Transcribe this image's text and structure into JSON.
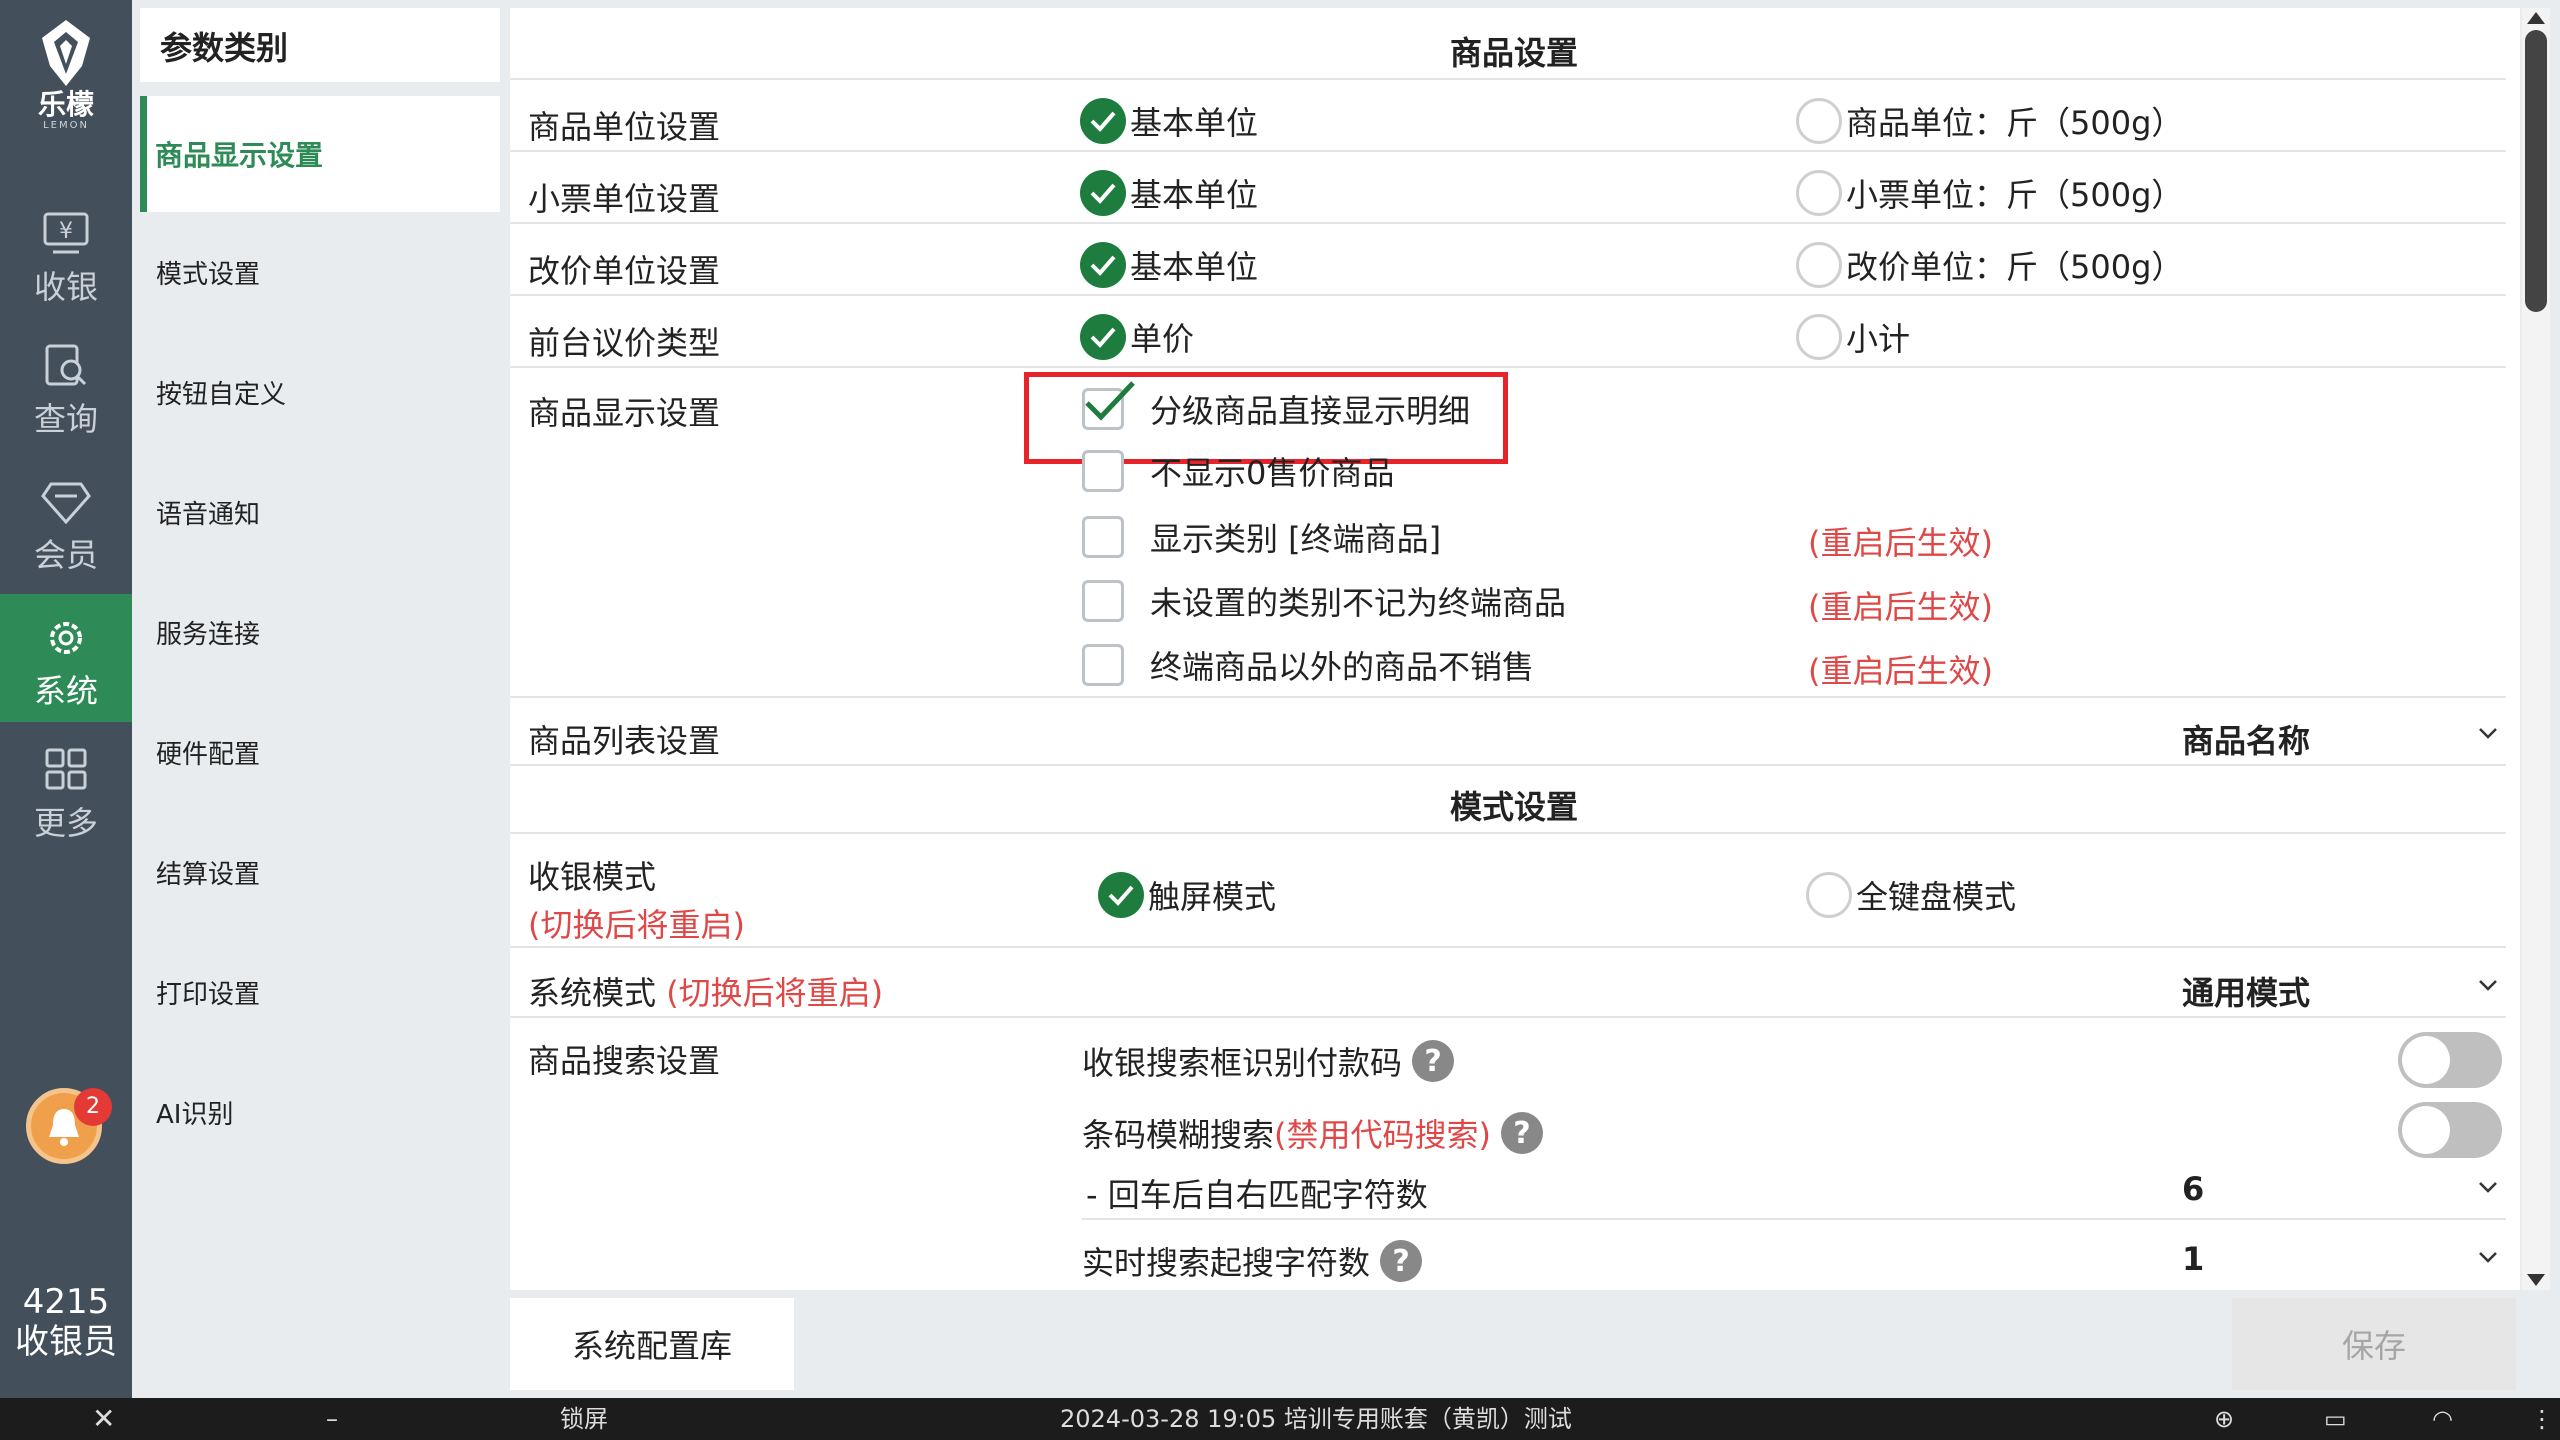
{
  "app": {
    "brand_cn": "乐檬",
    "brand_en": "LEMON",
    "user_id": "4215",
    "user_role": "收银员",
    "notification_count": "2"
  },
  "rail": [
    {
      "label": "收银",
      "icon": "cashier-icon"
    },
    {
      "label": "查询",
      "icon": "search-doc-icon"
    },
    {
      "label": "会员",
      "icon": "diamond-icon"
    },
    {
      "label": "系统",
      "icon": "gear-icon",
      "active": true
    },
    {
      "label": "更多",
      "icon": "grid-icon"
    }
  ],
  "categories": {
    "header": "参数类别",
    "items": [
      "商品显示设置",
      "模式设置",
      "按钮自定义",
      "语音通知",
      "服务连接",
      "硬件配置",
      "结算设置",
      "打印设置",
      "AI识别"
    ]
  },
  "product_settings": {
    "title": "商品设置",
    "unit_row": {
      "label": "商品单位设置",
      "opt_a": "基本单位",
      "opt_b": "商品单位：斤（500g）"
    },
    "receipt_row": {
      "label": "小票单位设置",
      "opt_a": "基本单位",
      "opt_b": "小票单位：斤（500g）"
    },
    "price_row": {
      "label": "改价单位设置",
      "opt_a": "基本单位",
      "opt_b": "改价单位：斤（500g）"
    },
    "bargain_row": {
      "label": "前台议价类型",
      "opt_a": "单价",
      "opt_b": "小计"
    },
    "display_row": {
      "label": "商品显示设置",
      "checks": [
        {
          "text": "分级商品直接显示明细",
          "checked": true,
          "note": ""
        },
        {
          "text": "不显示0售价商品",
          "checked": false,
          "note": ""
        },
        {
          "text": "显示类别 [终端商品]",
          "checked": false,
          "note": "(重启后生效)"
        },
        {
          "text": "未设置的类别不记为终端商品",
          "checked": false,
          "note": "(重启后生效)"
        },
        {
          "text": "终端商品以外的商品不销售",
          "checked": false,
          "note": "(重启后生效)"
        }
      ]
    },
    "list_row": {
      "label": "商品列表设置",
      "value": "商品名称"
    }
  },
  "mode_settings": {
    "title": "模式设置",
    "cash_mode": {
      "label": "收银模式",
      "note": "(切换后将重启)",
      "opt_a": "触屏模式",
      "opt_b": "全键盘模式"
    },
    "system_mode": {
      "label": "系统模式",
      "note": "(切换后将重启)",
      "value": "通用模式"
    },
    "search": {
      "label": "商品搜索设置",
      "pay_code": {
        "text": "收银搜索框识别付款码",
        "on": false
      },
      "fuzzy": {
        "text": "条码模糊搜索",
        "note": "(禁用代码搜索)",
        "on": false
      },
      "match_chars": {
        "text": "- 回车后自右匹配字符数",
        "value": "6"
      },
      "realtime": {
        "text": "实时搜索起搜字符数",
        "value": "1"
      }
    }
  },
  "footer": {
    "config_lib": "系统配置库",
    "save": "保存"
  },
  "taskbar": {
    "lock": "锁屏",
    "status": "2024-03-28 19:05 培训专用账套（黄凯）测试"
  },
  "colors": {
    "accent": "#2e8b57",
    "rail": "#434f5b",
    "warning": "#e04848",
    "highlight": "#e8242b"
  }
}
